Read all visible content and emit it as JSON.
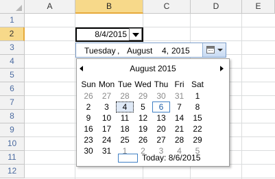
{
  "sheet": {
    "columns": [
      "A",
      "B",
      "C",
      "D",
      "E"
    ],
    "selected_column": "B",
    "rows": [
      "1",
      "2",
      "3",
      "4",
      "5",
      "6",
      "7",
      "8",
      "9",
      "10",
      "11",
      "12"
    ],
    "selected_row": "2",
    "active_cell_value": "8/4/2015"
  },
  "date_editor": {
    "weekday": "Tuesday",
    "separator": ",",
    "month": "August",
    "day": "4,",
    "year": "2015"
  },
  "calendar": {
    "title": "August 2015",
    "weekdays": [
      "Sun",
      "Mon",
      "Tue",
      "Wed",
      "Thu",
      "Fri",
      "Sat"
    ],
    "weeks": [
      [
        "26",
        "27",
        "28",
        "29",
        "30",
        "31",
        "1"
      ],
      [
        "2",
        "3",
        "4",
        "5",
        "6",
        "7",
        "8"
      ],
      [
        "9",
        "10",
        "11",
        "12",
        "13",
        "14",
        "15"
      ],
      [
        "16",
        "17",
        "18",
        "19",
        "20",
        "21",
        "22"
      ],
      [
        "23",
        "24",
        "25",
        "26",
        "27",
        "28",
        "29"
      ],
      [
        "30",
        "31",
        "1",
        "2",
        "3",
        "4",
        "5"
      ]
    ],
    "other_month_cells": [
      [
        0,
        0
      ],
      [
        0,
        1
      ],
      [
        0,
        2
      ],
      [
        0,
        3
      ],
      [
        0,
        4
      ],
      [
        0,
        5
      ],
      [
        5,
        2
      ],
      [
        5,
        3
      ],
      [
        5,
        4
      ],
      [
        5,
        5
      ],
      [
        5,
        6
      ]
    ],
    "selected_cell": [
      1,
      2
    ],
    "today_cell": [
      1,
      4
    ],
    "today_label": "Today: 8/6/2015"
  },
  "colors": {
    "selection_header": "#f7d98a",
    "today_border": "#3f7fc4",
    "other_month_text": "#8a8a8a"
  }
}
